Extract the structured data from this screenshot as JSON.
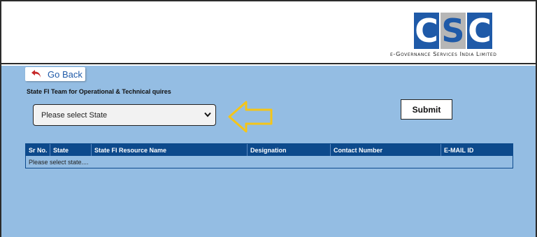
{
  "header": {
    "logo_letters": [
      "C",
      "S",
      "C"
    ],
    "tagline": "e-Governance Services India Limited"
  },
  "nav": {
    "go_back_label": "Go Back"
  },
  "form": {
    "section_title": "State FI Team for Operational & Technical quires",
    "state_select_value": "Please select State",
    "submit_label": "Submit"
  },
  "table": {
    "columns": [
      "Sr No.",
      "State",
      "State FI Resource Name",
      "Designation",
      "Contact Number",
      "E-MAIL ID"
    ],
    "empty_message": "Please select state...."
  },
  "colors": {
    "brand_blue": "#1f5aa8",
    "page_bg": "#94bde3",
    "table_header": "#0d4a8c",
    "arrow_yellow": "#f5c518"
  }
}
